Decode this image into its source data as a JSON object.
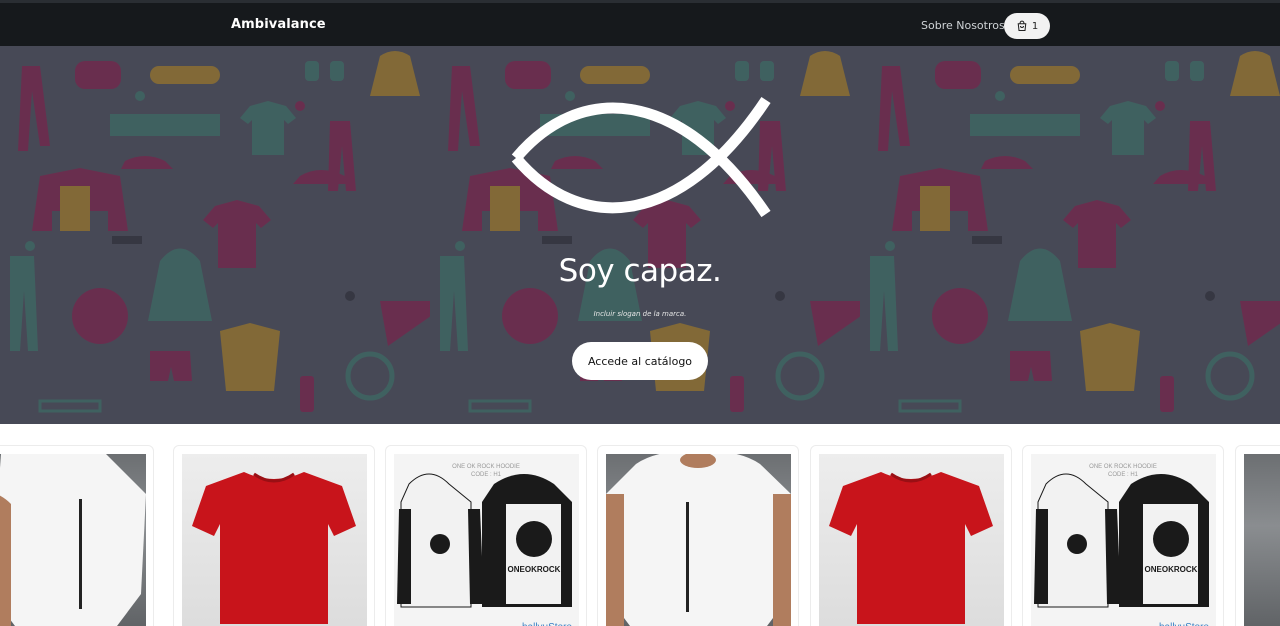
{
  "navbar": {
    "brand": "Ambivalance",
    "about_link": "Sobre Nosotros",
    "cart": {
      "icon": "shopping-bag-icon",
      "count": "1"
    }
  },
  "hero": {
    "logo": "ichthys-fish-logo",
    "title": "Soy capaz.",
    "slogan": "Incluir slogan de la marca.",
    "cta_label": "Accede al catálogo"
  },
  "products": {
    "cards": [
      {
        "image": "white-tshirt-model"
      },
      {
        "image": "red-tshirt"
      },
      {
        "image": "hoodie-pair"
      },
      {
        "image": "white-tshirt-model"
      },
      {
        "image": "red-tshirt"
      },
      {
        "image": "hoodie-pair"
      },
      {
        "image": "white-tshirt-model"
      }
    ],
    "hoodie_print": "ONE OK ROCK HOODIE\nCODE : H1",
    "hoodie_brand": "ONEOKROCK",
    "watermark": "hallyuStore"
  },
  "colors": {
    "navbar_bg": "#16191c",
    "hero_overlay": "#2d2e3a",
    "accent_magenta": "#9c2e60",
    "accent_teal": "#4f8a80",
    "accent_mustard": "#c89a35"
  }
}
